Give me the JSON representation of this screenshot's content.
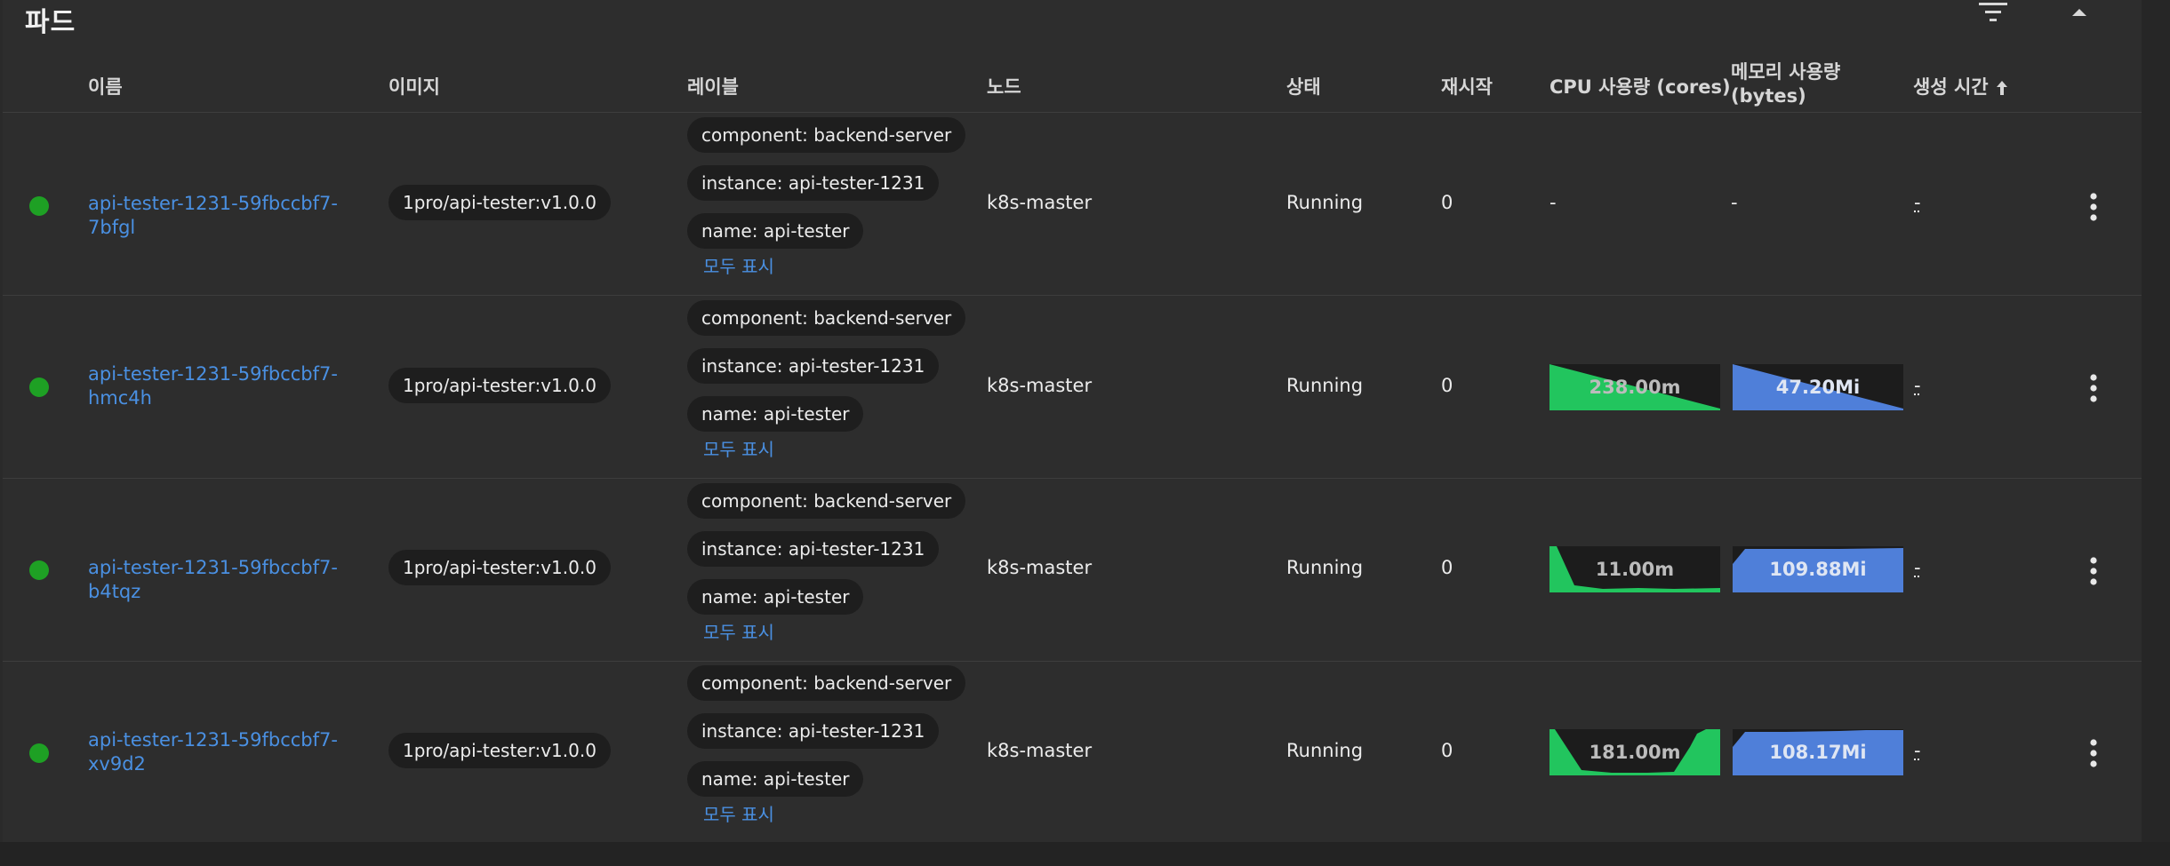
{
  "page": {
    "title": "파드"
  },
  "icons": {
    "filter": "filter-icon",
    "collapse": "chevron-up-icon",
    "sort": "arrow-up-icon",
    "menu": "more-vert-icon",
    "status": "status-dot-icon"
  },
  "colors": {
    "status_running": "#1ea024",
    "link": "#4a90e2",
    "cpu_spark": "#22c55e",
    "memory_spark": "#4f7fd9"
  },
  "table": {
    "columns": {
      "name": "이름",
      "image": "이미지",
      "labels": "레이블",
      "node": "노드",
      "status": "상태",
      "restarts": "재시작",
      "cpu": "CPU 사용량 (cores)",
      "memory": "메모리 사용량 (bytes)",
      "created": "생성 시간"
    },
    "rows": [
      {
        "name_line1": "api-tester-1231-59fbccbf7-7bfgl",
        "name_line2": "",
        "image": "1pro/api-tester:v1.0.0",
        "labels": [
          "component: backend-server",
          "instance: api-tester-1231",
          "name: api-tester"
        ],
        "show_all": "모두 표시",
        "node": "k8s-master",
        "status": "Running",
        "restarts": "0",
        "cpu": "-",
        "memory": "-",
        "created": "-"
      },
      {
        "name_line1": "api-tester-1231-59fbccbf7-",
        "name_line2": "hmc4h",
        "image": "1pro/api-tester:v1.0.0",
        "labels": [
          "component: backend-server",
          "instance: api-tester-1231",
          "name: api-tester"
        ],
        "show_all": "모두 표시",
        "node": "k8s-master",
        "status": "Running",
        "restarts": "0",
        "cpu": "238.00m",
        "memory": "47.20Mi",
        "created": "-"
      },
      {
        "name_line1": "api-tester-1231-59fbccbf7-b4tqz",
        "name_line2": "",
        "image": "1pro/api-tester:v1.0.0",
        "labels": [
          "component: backend-server",
          "instance: api-tester-1231",
          "name: api-tester"
        ],
        "show_all": "모두 표시",
        "node": "k8s-master",
        "status": "Running",
        "restarts": "0",
        "cpu": "11.00m",
        "memory": "109.88Mi",
        "created": "-"
      },
      {
        "name_line1": "api-tester-1231-59fbccbf7-",
        "name_line2": "xv9d2",
        "image": "1pro/api-tester:v1.0.0",
        "labels": [
          "component: backend-server",
          "instance: api-tester-1231",
          "name: api-tester"
        ],
        "show_all": "모두 표시",
        "node": "k8s-master",
        "status": "Running",
        "restarts": "0",
        "cpu": "181.00m",
        "memory": "108.17Mi",
        "created": "-"
      }
    ]
  }
}
